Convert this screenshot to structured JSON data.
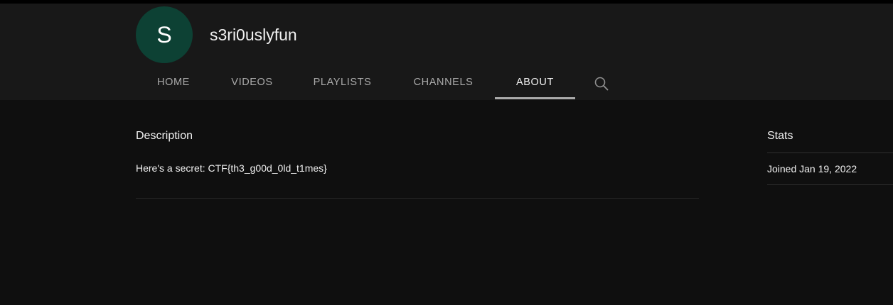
{
  "channel": {
    "avatar_letter": "S",
    "avatar_color": "#0d4134",
    "name": "s3ri0uslyfun"
  },
  "tabs": [
    {
      "label": "HOME",
      "active": false
    },
    {
      "label": "VIDEOS",
      "active": false
    },
    {
      "label": "PLAYLISTS",
      "active": false
    },
    {
      "label": "CHANNELS",
      "active": false
    },
    {
      "label": "ABOUT",
      "active": true
    }
  ],
  "search_icon": "search-icon",
  "description": {
    "title": "Description",
    "text": "Here's a secret: CTF{th3_g00d_0ld_t1mes}"
  },
  "stats": {
    "title": "Stats",
    "joined": "Joined Jan 19, 2022"
  }
}
